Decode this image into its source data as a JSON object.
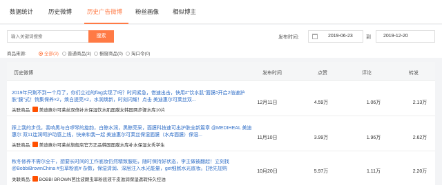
{
  "tabs": [
    {
      "label": "数据统计"
    },
    {
      "label": "历史微博"
    },
    {
      "label": "历史广告微博"
    },
    {
      "label": "粉丝画像"
    },
    {
      "label": "相似博主"
    }
  ],
  "active_tab": "历史广告微博",
  "colors": {
    "accent": "#ff7a45",
    "link": "#2f6ec7",
    "shop": "#ff5000"
  },
  "search": {
    "placeholder": "输入关键词搜索",
    "button": "搜索"
  },
  "date_filter": {
    "label": "发布时间:",
    "start": "2019-06-23",
    "separator": "到",
    "end": "2019-12-20"
  },
  "source": {
    "label": "商品来源:",
    "options": [
      "全部(3)",
      "普通商品(3)",
      "橱窗商品(0)",
      "淘口令(0)"
    ],
    "selected": "全部(3)"
  },
  "table": {
    "headers": {
      "content": "历史微博",
      "date": "发布时间",
      "likes": "点赞",
      "comments": "评论",
      "reposts": "转发"
    },
    "rows": [
      {
        "text": "2019年只剩不到一个月了，你们立过的flag实现了吗？时间紧急，借速出击，快用#\"饮水肌\"面膜#开启2倍速护肤\"膜\"式！悄集保养×2，焕白提亮×2，水润焕新，时刻闪耀！点击 美迪惠尔可莱丝双...",
        "product_label": "关联商品:",
        "product": "美迪惠尔可莱丝双倍补水保湿饮水肌面膜女韩国两步骤水库10片",
        "date": "12月11日",
        "likes": "4.59万",
        "comments": "1.06万",
        "reposts": "2.13万"
      },
      {
        "text": "踩上我的步伐，奏响黑与白啰琴的旋韵，白鲸水润，黑鲸亮采，面膜科技速可出护肤全新篇章 @MEDIHEAL 美迪惠尔 双11连润呵护动感上线，快来和我一起 美迪惠尔可莱丝保湿面膜（水库面膜）保湿...",
        "product_label": "关联商品:",
        "product": "美迪惠尔可莱丝旗舰店官方正品韩国面膜水库补水保湿女秀学生",
        "date": "11月10日",
        "likes": "3.99万",
        "comments": "1.96万",
        "reposts": "2.62万"
      },
      {
        "text": "秋冬修养不需尔全干，想要长时间的工作底妆仍然精致服贴，随时保持好状态，李主做被翻起！立刻找@BobbiBrownChina #虫草粉底# 杂数，保湿清润、深层注入水光能量，get细腻水光底妆。【抢先加购",
        "product_label": "关联商品:",
        "product": "BOBBI BROWN芭比波朗虫草粉底液干皮滋润保湿遮瑕持久控油",
        "date": "10月20日",
        "likes": "5.97万",
        "comments": "1.11万",
        "reposts": "2.20万"
      }
    ]
  }
}
